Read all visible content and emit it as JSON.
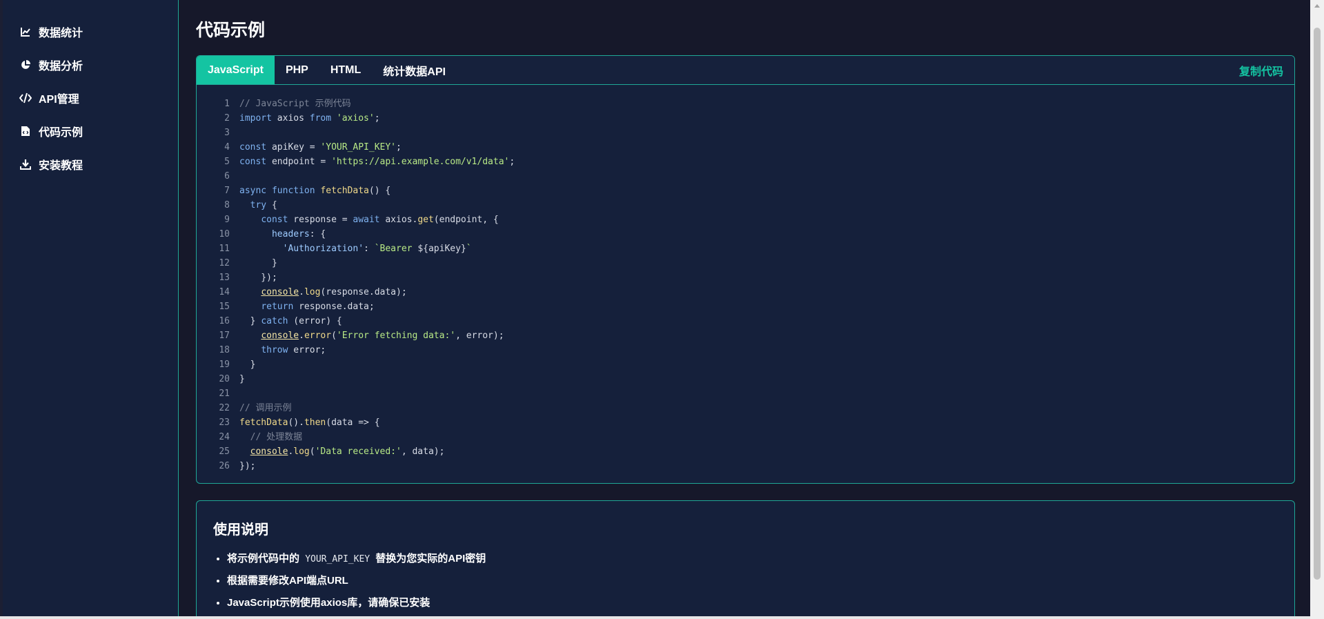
{
  "sidebar": {
    "items": [
      {
        "label": "数据统计",
        "icon": "line-chart-icon"
      },
      {
        "label": "数据分析",
        "icon": "pie-chart-icon"
      },
      {
        "label": "API管理",
        "icon": "code-icon"
      },
      {
        "label": "代码示例",
        "icon": "file-code-icon"
      },
      {
        "label": "安装教程",
        "icon": "download-icon"
      }
    ]
  },
  "main": {
    "title": "代码示例",
    "tabs": [
      {
        "label": "JavaScript",
        "active": true
      },
      {
        "label": "PHP",
        "active": false
      },
      {
        "label": "HTML",
        "active": false
      },
      {
        "label": "统计数据API",
        "active": false
      }
    ],
    "copy_label": "复制代码",
    "code_lines": [
      "// JavaScript 示例代码",
      "import axios from 'axios';",
      "",
      "const apiKey = 'YOUR_API_KEY';",
      "const endpoint = 'https://api.example.com/v1/data';",
      "",
      "async function fetchData() {",
      "  try {",
      "    const response = await axios.get(endpoint, {",
      "      headers: {",
      "        'Authorization': `Bearer ${apiKey}`",
      "      }",
      "    });",
      "    console.log(response.data);",
      "    return response.data;",
      "  } catch (error) {",
      "    console.error('Error fetching data:', error);",
      "    throw error;",
      "  }",
      "}",
      "",
      "// 调用示例",
      "fetchData().then(data => {",
      "  // 处理数据",
      "  console.log('Data received:', data);",
      "});"
    ]
  },
  "usage": {
    "title": "使用说明",
    "items": [
      {
        "before": "将示例代码中的",
        "code": "YOUR_API_KEY",
        "after": "替换为您实际的API密钥"
      },
      {
        "before": "根据需要修改API端点URL",
        "code": "",
        "after": ""
      },
      {
        "before": "JavaScript示例使用axios库，请确保已安装",
        "code": "",
        "after": ""
      }
    ]
  },
  "colors": {
    "accent": "#14c4a2",
    "sidebar_bg": "#15203b",
    "page_bg": "#16182a",
    "border": "#1fa897"
  }
}
